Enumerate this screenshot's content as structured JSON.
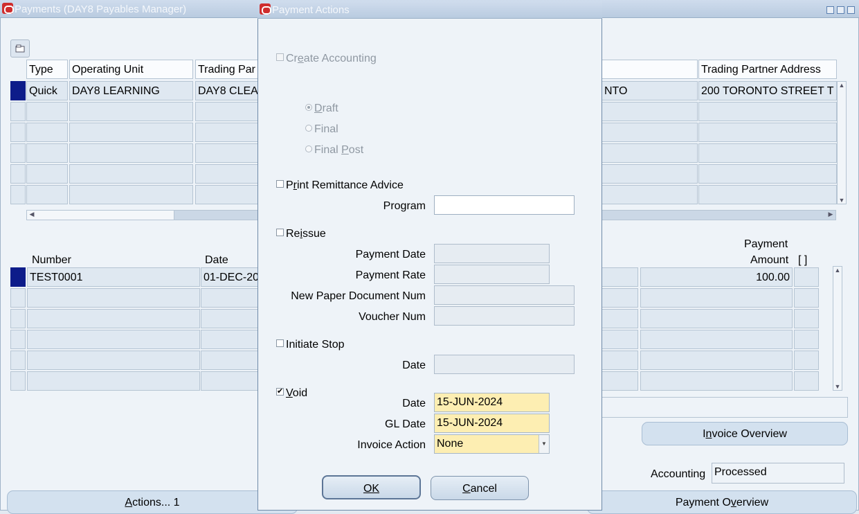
{
  "main_window": {
    "title": "Payments (DAY8 Payables Manager)",
    "top_table": {
      "headers": [
        "Type",
        "Operating Unit",
        "Trading Par",
        "Trading Partner Address"
      ],
      "first_row": [
        "Quick",
        "DAY8 LEARNING",
        "DAY8 CLEA",
        "NTO",
        "200 TORONTO STREET  T"
      ]
    },
    "bottom_table": {
      "headers": {
        "number": "Number",
        "date": "Date",
        "amount_line1": "Payment",
        "amount_line2": "Amount",
        "bracket": "[ ]"
      },
      "first_row": {
        "number": "TEST0001",
        "date": "01-DEC-20",
        "amount": "100.00"
      }
    },
    "invoice_overview_pre": "I",
    "invoice_overview_mnem": "n",
    "invoice_overview_post": "voice Overview",
    "accounting_label": "Accounting",
    "accounting_value": "Processed",
    "actions_mnem": "A",
    "actions_post": "ctions... 1",
    "payment_overview_pre": "Payment O",
    "payment_overview_mnem": "v",
    "payment_overview_post": "erview"
  },
  "dialog": {
    "title": "Payment Actions",
    "create_accounting": {
      "pre": "Cr",
      "mnem": "e",
      "post": "ate Accounting",
      "checked": false
    },
    "accounting_modes": [
      {
        "pre": "",
        "mnem": "D",
        "post": "raft",
        "selected": true
      },
      {
        "pre": "Final",
        "mnem": "",
        "post": "",
        "selected": false
      },
      {
        "pre": "Final ",
        "mnem": "P",
        "post": "ost",
        "selected": false
      }
    ],
    "print_remittance": {
      "pre": "P",
      "mnem": "r",
      "post": "int Remittance Advice",
      "checked": false
    },
    "program_label": "Program",
    "program_value": "",
    "reissue": {
      "pre": "Re",
      "mnem": "i",
      "post": "ssue",
      "checked": false
    },
    "payment_date_label": "Payment Date",
    "payment_rate_label": "Payment Rate",
    "new_paper_doc_label": "New Paper Document Num",
    "voucher_num_label": "Voucher Num",
    "initiate_stop": {
      "label": "Initiate Stop",
      "checked": false
    },
    "stop_date_label": "Date",
    "void": {
      "mnem": "V",
      "post": "oid",
      "checked": true
    },
    "void_date_label": "Date",
    "void_date_value": "15-JUN-2024",
    "gl_date_label": "GL Date",
    "gl_date_value": "15-JUN-2024",
    "invoice_action_label": "Invoice Action",
    "invoice_action_value": "None",
    "ok_label": "OK",
    "cancel_pre": "",
    "cancel_mnem": "C",
    "cancel_post": "ancel"
  },
  "colors": {
    "required_field": "#fdeeb2",
    "current_row": "#0d1c8a",
    "oracle_icon": "#cf2d2d"
  }
}
